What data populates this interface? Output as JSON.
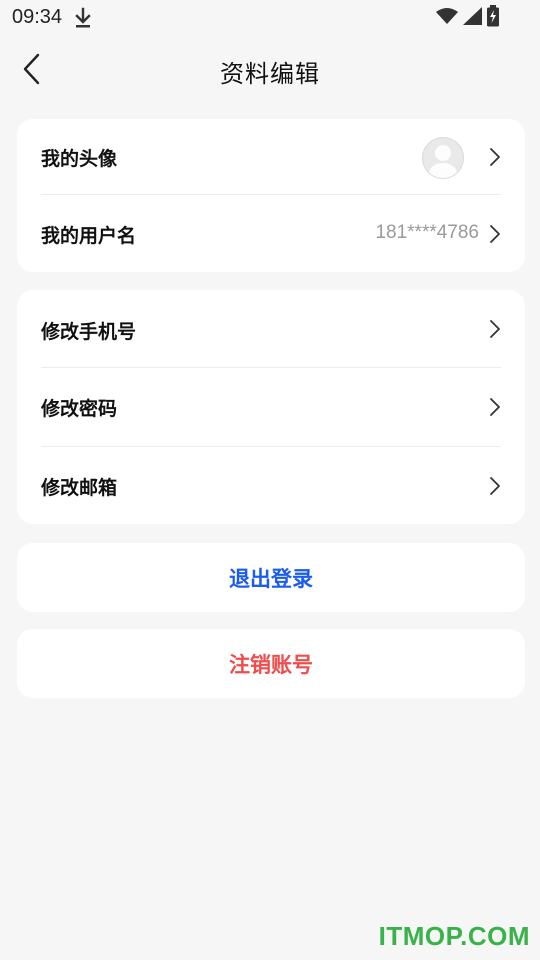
{
  "status_bar": {
    "time": "09:34",
    "icons": [
      "download-icon",
      "wifi-icon",
      "signal-icon",
      "battery-charging-icon"
    ]
  },
  "header": {
    "title": "资料编辑",
    "back_icon": "chevron-left-icon"
  },
  "profile": {
    "avatar_label": "我的头像",
    "username_label": "我的用户名",
    "username_value": "181****4786"
  },
  "security": {
    "change_phone": "修改手机号",
    "change_password": "修改密码",
    "change_email": "修改邮箱"
  },
  "actions": {
    "logout": "退出登录",
    "logout_color": "#1a5cf0",
    "delete_account": "注销账号",
    "delete_color": "#f04c4c"
  },
  "watermark": "ITMOP.COM"
}
